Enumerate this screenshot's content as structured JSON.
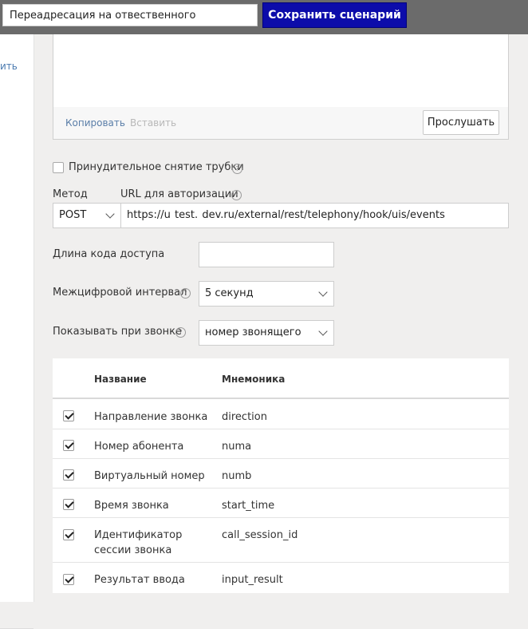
{
  "header": {
    "scenario_name": "Переадресация на отвественного",
    "save_label": "Сохранить сценарий"
  },
  "left_panel": {
    "link_fragment": "ить"
  },
  "message": {
    "copy_label": "Копировать",
    "paste_label": "Вставить",
    "listen_label": "Прослушать"
  },
  "settings": {
    "force_pickup_label": "Принудительное снятие трубки",
    "method_label": "Метод",
    "method_value": "POST",
    "url_label": "URL для авторизации",
    "url_value": "https://u  test.  dev.ru/external/rest/telephony/hook/uis/events",
    "access_code_label": "Длина кода доступа",
    "access_code_value": "",
    "interval_label": "Межцифровой интервал",
    "interval_value": "5 секунд",
    "show_label": "Показывать при звонке",
    "show_value": "номер звонящего"
  },
  "table": {
    "col_name": "Название",
    "col_mnemonic": "Мнемоника",
    "rows": [
      {
        "name": "Направление звонка",
        "mnemonic": "direction",
        "checked": true
      },
      {
        "name": "Номер абонента",
        "mnemonic": "numa",
        "checked": true
      },
      {
        "name": "Виртуальный номер",
        "mnemonic": "numb",
        "checked": true
      },
      {
        "name": "Время звонка",
        "mnemonic": "start_time",
        "checked": true
      },
      {
        "name": "Идентификатор сессии звонка",
        "mnemonic": "call_session_id",
        "checked": true
      },
      {
        "name": "Результат ввода",
        "mnemonic": "input_result",
        "checked": true
      }
    ]
  },
  "colors": {
    "save_button": "#0c0caa",
    "topbar": "#6b6b6b",
    "link": "#5a7ea8"
  }
}
